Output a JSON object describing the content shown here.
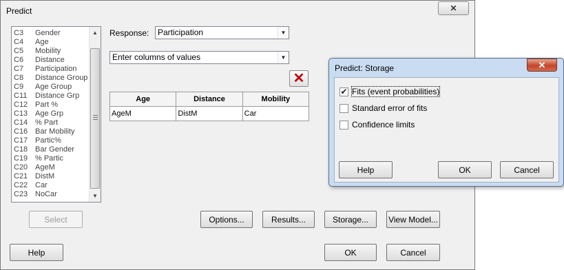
{
  "dialog": {
    "title": "Predict",
    "close_label": "✕",
    "column_list": [
      {
        "code": "C3",
        "name": "Gender"
      },
      {
        "code": "C4",
        "name": "Age"
      },
      {
        "code": "C5",
        "name": "Mobility"
      },
      {
        "code": "C6",
        "name": "Distance"
      },
      {
        "code": "C7",
        "name": "Participation"
      },
      {
        "code": "C8",
        "name": "Distance Group"
      },
      {
        "code": "C9",
        "name": "Age Group"
      },
      {
        "code": "C11",
        "name": "Distance Grp"
      },
      {
        "code": "C12",
        "name": "Part %"
      },
      {
        "code": "C13",
        "name": "Age Grp"
      },
      {
        "code": "C14",
        "name": "% Part"
      },
      {
        "code": "C16",
        "name": "Bar Mobility"
      },
      {
        "code": "C17",
        "name": "Partic%"
      },
      {
        "code": "C18",
        "name": "Bar Gender"
      },
      {
        "code": "C19",
        "name": "% Partic"
      },
      {
        "code": "C20",
        "name": "AgeM"
      },
      {
        "code": "C21",
        "name": "DistM"
      },
      {
        "code": "C22",
        "name": "Car"
      },
      {
        "code": "C23",
        "name": "NoCar"
      }
    ],
    "response_label": "Response:",
    "response_value": "Participation",
    "mode_value": "Enter columns of values",
    "delete_icon": "red-x-icon",
    "table": {
      "headers": [
        "Age",
        "Distance",
        "Mobility"
      ],
      "rows": [
        [
          "AgeM",
          "DistM",
          "Car"
        ]
      ]
    },
    "buttons": {
      "select": "Select",
      "options": "Options...",
      "results": "Results...",
      "storage": "Storage...",
      "view_model": "View Model...",
      "help": "Help",
      "ok": "OK",
      "cancel": "Cancel"
    }
  },
  "storage_dialog": {
    "title": "Predict: Storage",
    "close_label": "✕",
    "options": [
      {
        "label": "Fits (event probabilities)",
        "checked": true
      },
      {
        "label": "Standard error of fits",
        "checked": false
      },
      {
        "label": "Confidence limits",
        "checked": false
      }
    ],
    "buttons": {
      "help": "Help",
      "ok": "OK",
      "cancel": "Cancel"
    }
  }
}
